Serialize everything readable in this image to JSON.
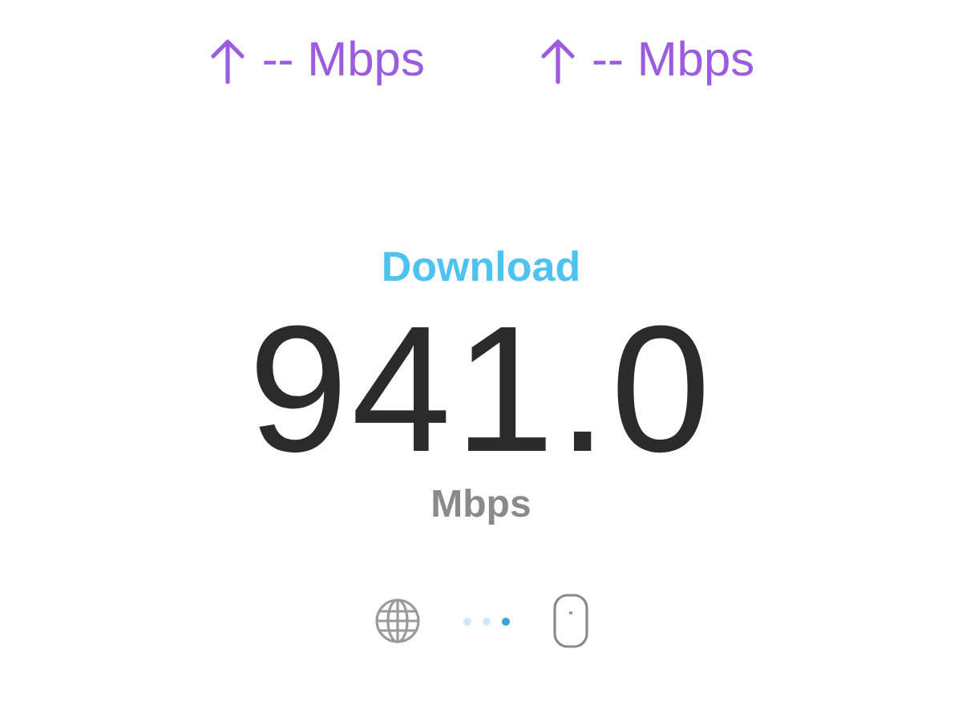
{
  "upload_readings": [
    {
      "value": "-- Mbps"
    },
    {
      "value": "-- Mbps"
    }
  ],
  "test": {
    "label": "Download",
    "speed": "941.0",
    "unit": "Mbps"
  },
  "progress_dots": [
    {
      "selected": false
    },
    {
      "selected": false
    },
    {
      "selected": true
    }
  ]
}
